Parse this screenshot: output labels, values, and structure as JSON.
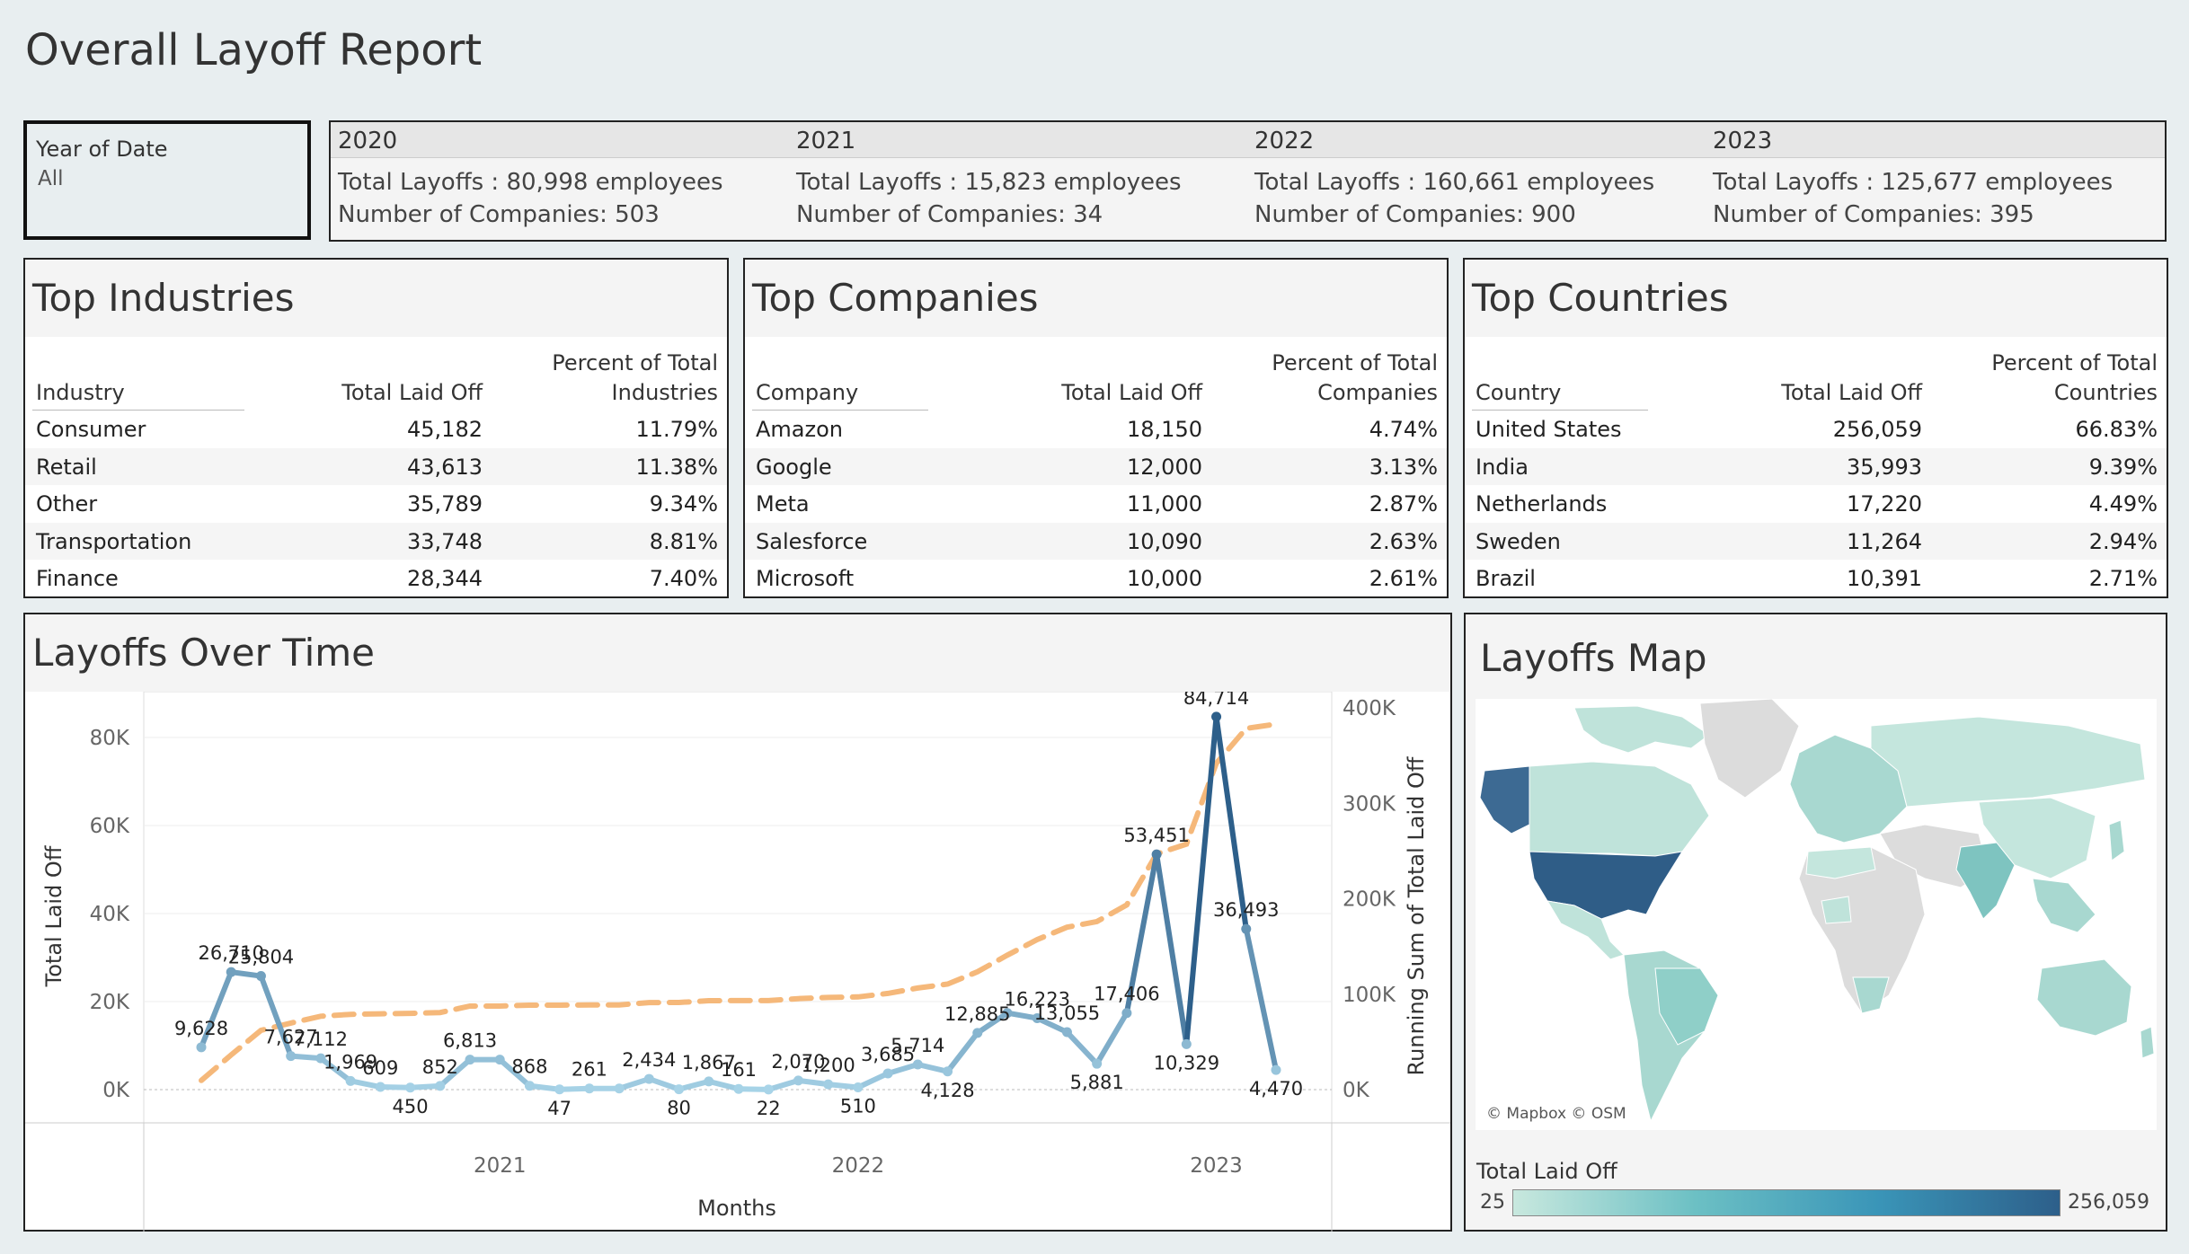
{
  "title": "Overall Layoff Report",
  "filter": {
    "label": "Year of Date",
    "value": "All"
  },
  "kpis": [
    {
      "year": "2020",
      "total": "Total Layoffs : 80,998 employees",
      "companies": "Number of Companies: 503"
    },
    {
      "year": "2021",
      "total": "Total Layoffs : 15,823 employees",
      "companies": "Number of Companies: 34"
    },
    {
      "year": "2022",
      "total": "Total Layoffs : 160,661 employees",
      "companies": "Number of Companies: 900"
    },
    {
      "year": "2023",
      "total": "Total Layoffs : 125,677 employees",
      "companies": "Number of Companies: 395"
    }
  ],
  "industries": {
    "title": "Top Industries",
    "headers": {
      "name": "Industry",
      "val": "Total Laid Off",
      "pct1": "Percent of Total",
      "pct2": "Industries"
    },
    "rows": [
      {
        "name": "Consumer",
        "val": "45,182",
        "pct": "11.79%"
      },
      {
        "name": "Retail",
        "val": "43,613",
        "pct": "11.38%"
      },
      {
        "name": "Other",
        "val": "35,789",
        "pct": "9.34%"
      },
      {
        "name": "Transportation",
        "val": "33,748",
        "pct": "8.81%"
      },
      {
        "name": "Finance",
        "val": "28,344",
        "pct": "7.40%"
      }
    ]
  },
  "companies": {
    "title": "Top Companies",
    "headers": {
      "name": "Company",
      "val": "Total Laid Off",
      "pct1": "Percent of Total",
      "pct2": "Companies"
    },
    "rows": [
      {
        "name": "Amazon",
        "val": "18,150",
        "pct": "4.74%"
      },
      {
        "name": "Google",
        "val": "12,000",
        "pct": "3.13%"
      },
      {
        "name": "Meta",
        "val": "11,000",
        "pct": "2.87%"
      },
      {
        "name": "Salesforce",
        "val": "10,090",
        "pct": "2.63%"
      },
      {
        "name": "Microsoft",
        "val": "10,000",
        "pct": "2.61%"
      }
    ]
  },
  "countries": {
    "title": "Top Countries",
    "headers": {
      "name": "Country",
      "val": "Total Laid Off",
      "pct1": "Percent of Total",
      "pct2": "Countries"
    },
    "rows": [
      {
        "name": "United States",
        "val": "256,059",
        "pct": "66.83%"
      },
      {
        "name": "India",
        "val": "35,993",
        "pct": "9.39%"
      },
      {
        "name": "Netherlands",
        "val": "17,220",
        "pct": "4.49%"
      },
      {
        "name": "Sweden",
        "val": "11,264",
        "pct": "2.94%"
      },
      {
        "name": "Brazil",
        "val": "10,391",
        "pct": "2.71%"
      }
    ]
  },
  "map": {
    "title": "Layoffs Map",
    "attribution": "© Mapbox © OSM",
    "legend_title": "Total Laid Off",
    "legend_min": "25",
    "legend_max": "256,059",
    "colors": {
      "low": "#c8e8de",
      "mid": "#6cc0c4",
      "high": "#2d5f8a",
      "no_data": "#dcdcdc"
    }
  },
  "chart_data": {
    "type": "line",
    "title": "Layoffs Over Time",
    "xlabel": "Months",
    "ylabel": "Total Laid Off",
    "ylabel_right": "Running Sum of Total Laid Off",
    "ylim": [
      0,
      85000
    ],
    "ylim_right": [
      0,
      425000
    ],
    "yticks": [
      "0K",
      "20K",
      "40K",
      "60K",
      "80K"
    ],
    "yticks_right": [
      "0K",
      "100K",
      "200K",
      "300K",
      "400K"
    ],
    "xticks": [
      "2021",
      "2022",
      "2023"
    ],
    "x": [
      "2020-03",
      "2020-04",
      "2020-05",
      "2020-06",
      "2020-07",
      "2020-08",
      "2020-09",
      "2020-10",
      "2020-11",
      "2020-12",
      "2021-01",
      "2021-02",
      "2021-03",
      "2021-04",
      "2021-05",
      "2021-06",
      "2021-07",
      "2021-08",
      "2021-09",
      "2021-10",
      "2021-11",
      "2021-12",
      "2022-01",
      "2022-02",
      "2022-03",
      "2022-04",
      "2022-05",
      "2022-06",
      "2022-07",
      "2022-08",
      "2022-09",
      "2022-10",
      "2022-11",
      "2022-12",
      "2023-01",
      "2023-02",
      "2023-03"
    ],
    "series": [
      {
        "values": [
          9628,
          26710,
          25804,
          7627,
          7112,
          1969,
          609,
          450,
          852,
          6813,
          6813,
          868,
          47,
          261,
          261,
          2434,
          80,
          1867,
          161,
          22,
          2070,
          1200,
          510,
          3685,
          5714,
          4128,
          12885,
          17406,
          16223,
          13055,
          5881,
          17406,
          53451,
          10329,
          84714,
          36493,
          4470
        ],
        "labels": [
          "9,628",
          "26,710",
          "25,804",
          "7,627",
          "7,112",
          "1,969",
          "609",
          "450",
          "852",
          "6,813",
          "",
          "868",
          "47",
          "261",
          "",
          "2,434",
          "80",
          "1,867",
          "161",
          "22",
          "2,070",
          "1,200",
          "510",
          "3,685",
          "5,714",
          "4,128",
          "12,885",
          "",
          "16,223",
          "13,055",
          "5,881",
          "17,406",
          "53,451",
          "10,329",
          "84,714",
          "36,493",
          "4,470"
        ],
        "color_scale": [
          "#a8d4e8",
          "#2d5f8a"
        ]
      },
      {
        "values": [
          9628,
          36338,
          62142,
          69769,
          76881,
          78850,
          79459,
          79909,
          80761,
          87574,
          87574,
          88442,
          88489,
          88750,
          88750,
          91184,
          91264,
          93131,
          93292,
          93314,
          95384,
          96584,
          97094,
          100779,
          106493,
          110621,
          123506,
          140912,
          157135,
          170190,
          176071,
          193477,
          246928,
          257257,
          341971,
          378464,
          382934
        ],
        "color": "#f5b87a",
        "dashed": true
      }
    ]
  }
}
